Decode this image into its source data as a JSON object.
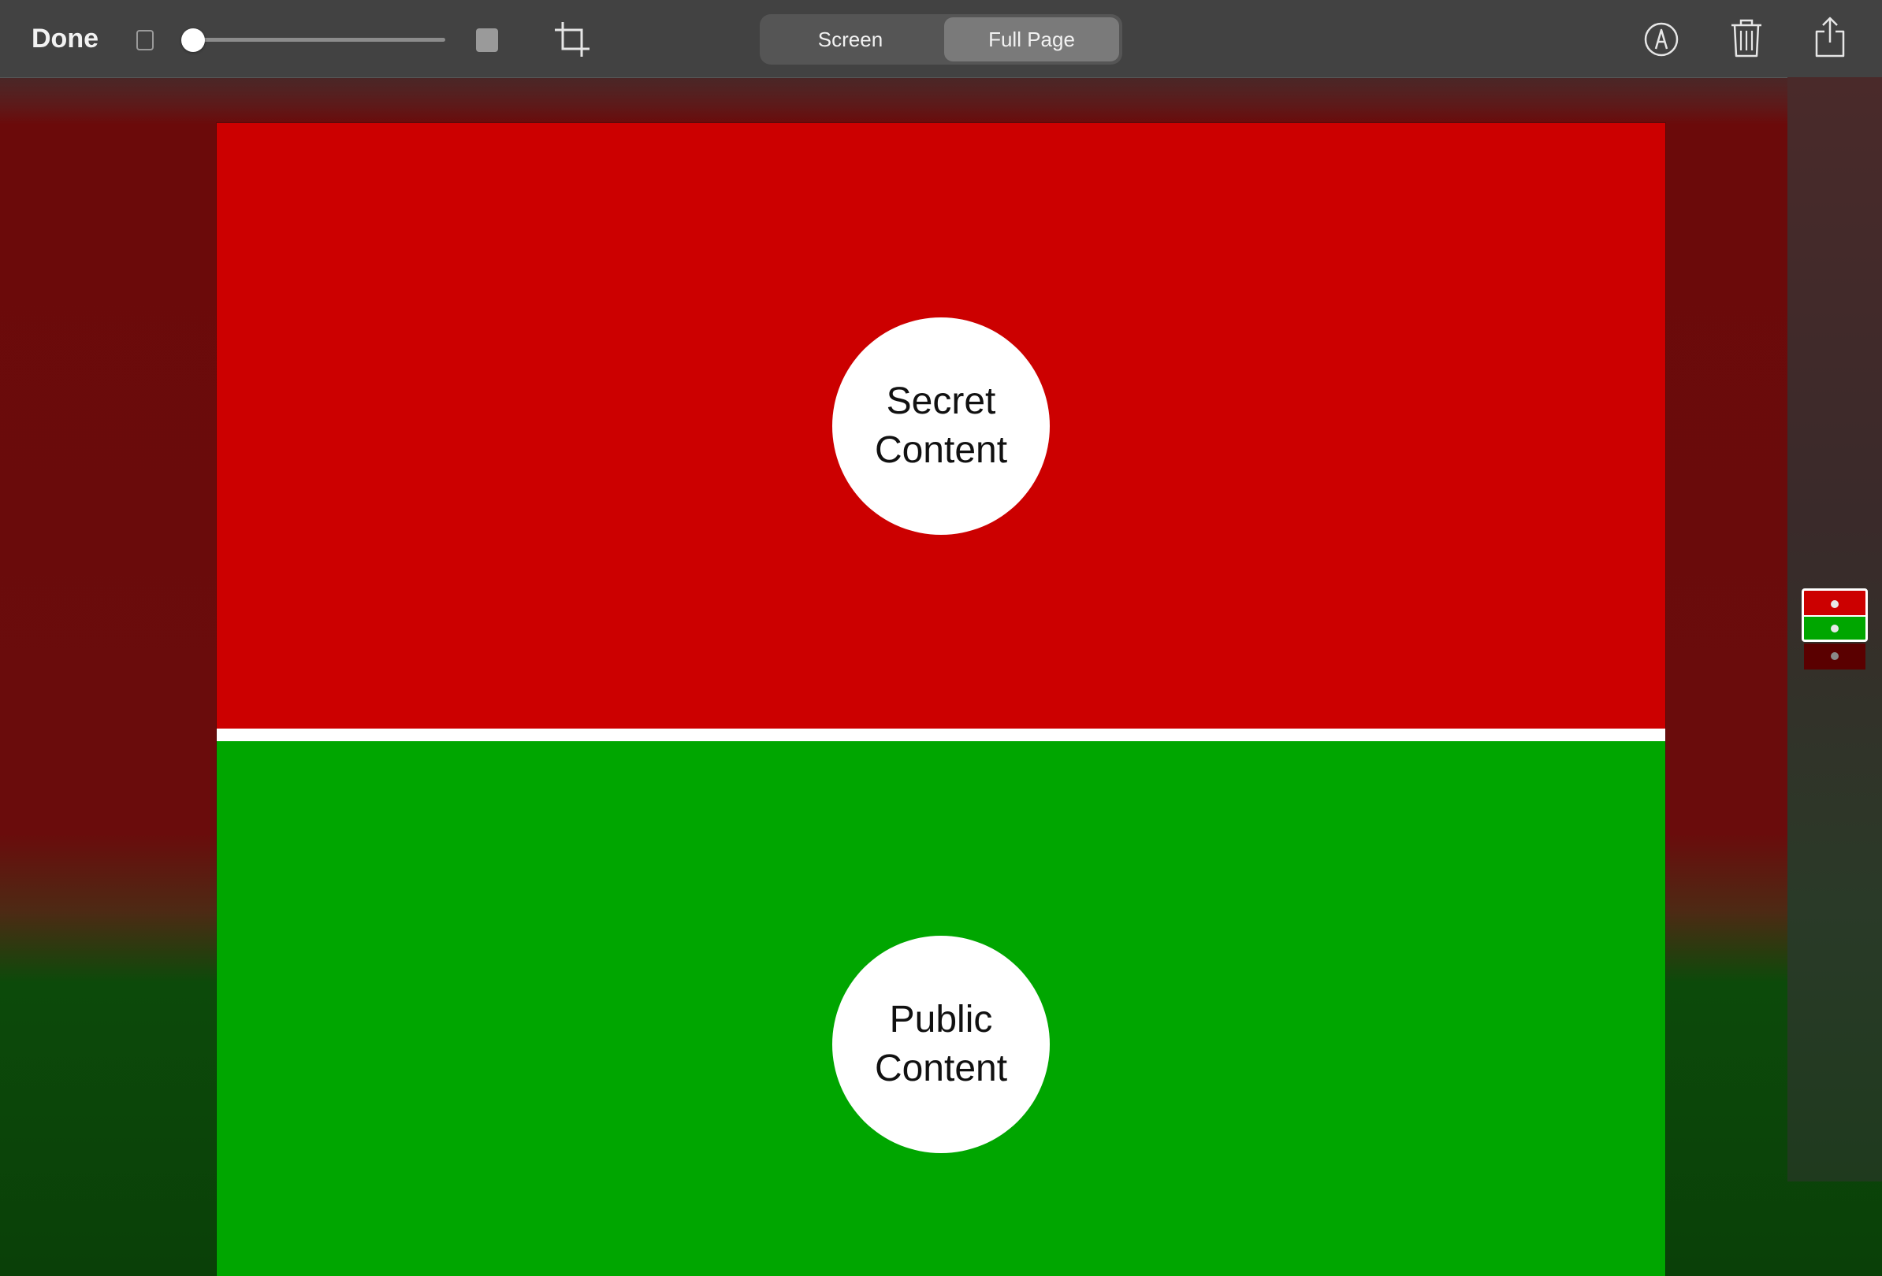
{
  "toolbar": {
    "done_label": "Done",
    "slider": {
      "value_percent": 0
    },
    "segments": [
      {
        "label": "Screen",
        "selected": false
      },
      {
        "label": "Full Page",
        "selected": true
      }
    ],
    "icons": {
      "size_small": "small-square-icon",
      "size_large": "large-square-icon",
      "crop": "crop-icon",
      "markup": "markup-pen-icon",
      "trash": "trash-icon",
      "share": "share-icon"
    }
  },
  "content": {
    "sections": [
      {
        "label_line1": "Secret",
        "label_line2": "Content",
        "color": "#cc0000"
      },
      {
        "label_line1": "Public",
        "label_line2": "Content",
        "color": "#00a600"
      }
    ]
  },
  "colors": {
    "toolbar_bg": "#424242",
    "red": "#cc0000",
    "green": "#00a600"
  }
}
